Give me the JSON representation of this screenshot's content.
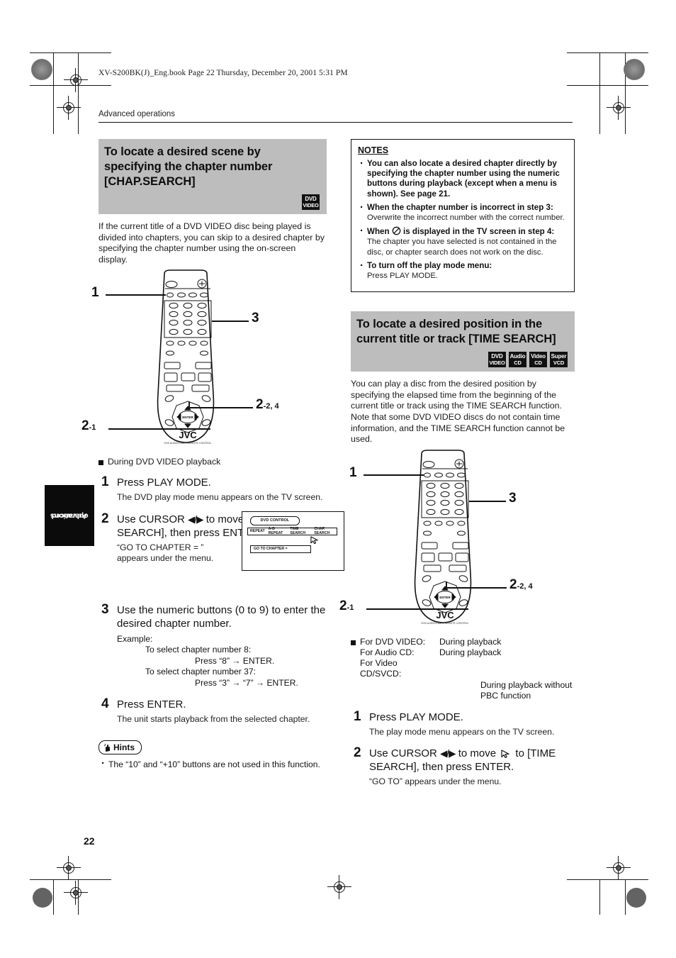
{
  "header": {
    "file_line": "XV-S200BK(J)_Eng.book  Page 22  Thursday, December 20, 2001  5:31 PM",
    "section": "Advanced operations"
  },
  "side_tab": {
    "line1": "Advanced",
    "line2": "operations"
  },
  "page_number": "22",
  "left": {
    "banner": {
      "title": "To locate a desired scene by specifying the chapter number [CHAP.SEARCH]",
      "badges": [
        {
          "top": "DVD",
          "bottom": "VIDEO"
        }
      ]
    },
    "intro": "If the current title of a DVD VIDEO disc being played is divided into chapters, you can skip to a desired chapter by specifying the chapter number using the on-screen display.",
    "remote_callouts": [
      {
        "num": "1",
        "sub": ""
      },
      {
        "num": "3",
        "sub": ""
      },
      {
        "num": "2",
        "sub": "-2, 4"
      },
      {
        "num": "2",
        "sub": "-1"
      }
    ],
    "condition": "During DVD VIDEO playback",
    "steps": [
      {
        "num": "1",
        "lead": "Press PLAY MODE.",
        "sub": "The DVD play mode menu appears on the TV screen."
      },
      {
        "num": "2",
        "lead_pre": "Use CURSOR ",
        "lead_cursor": "◀/▶",
        "lead_mid": " to move ",
        "lead_post": " to [CHAP. SEARCH], then press ENTER.",
        "sub": "“GO TO CHAPTER = ” appears under the menu."
      },
      {
        "num": "3",
        "lead": "Use the numeric buttons (0 to 9) to enter the desired chapter number.",
        "example_label": "Example:",
        "example_lines": [
          "To select chapter number 8:",
          "Press “8” → ENTER.",
          "To select chapter number 37:",
          "Press “3” → “7” → ENTER."
        ]
      },
      {
        "num": "4",
        "lead": "Press ENTER.",
        "sub": "The unit starts playback from the selected chapter."
      }
    ],
    "tv_screen": {
      "control_label": "DVD CONTROL",
      "menu_items": [
        "REPEAT",
        "A-B REPEAT",
        "TIME SEARCH",
        "CHAP. SEARCH"
      ],
      "goto_label": "GO TO CHAPTER ="
    },
    "hints": {
      "title": "Hints",
      "items": [
        "The “10” and “+10” buttons are not used in this function."
      ]
    }
  },
  "right": {
    "notes": {
      "title": "NOTES",
      "items": [
        {
          "bold": "You can also locate a desired chapter directly by specifying the chapter number using the numeric buttons during playback (except when a menu is shown). See page 21.",
          "plain": ""
        },
        {
          "bold": "When the chapter number is incorrect in step 3:",
          "plain": "Overwrite the incorrect number with the correct number."
        },
        {
          "bold_pre": "When ",
          "icon": "prohibited-icon",
          "bold_post": " is displayed in the TV screen in step 4:",
          "plain": "The chapter you have selected is not contained in the disc, or chapter search does not work on the disc."
        },
        {
          "bold": "To turn off the play mode menu:",
          "plain": "Press PLAY MODE."
        }
      ]
    },
    "banner": {
      "title": "To locate a desired position in the current title or track [TIME SEARCH]",
      "badges": [
        {
          "top": "DVD",
          "bottom": "VIDEO"
        },
        {
          "top": "Audio",
          "bottom": "CD"
        },
        {
          "top": "Video",
          "bottom": "CD"
        },
        {
          "top": "Super",
          "bottom": "VCD"
        }
      ]
    },
    "intro": "You can play a disc from the desired position by specifying the elapsed time from the beginning of the current title or track using the TIME SEARCH function. Note that some DVD VIDEO discs do not contain time information, and the TIME SEARCH function cannot be used.",
    "remote_callouts": [
      {
        "num": "1",
        "sub": ""
      },
      {
        "num": "3",
        "sub": ""
      },
      {
        "num": "2",
        "sub": "-2, 4"
      },
      {
        "num": "2",
        "sub": "-1"
      }
    ],
    "conditions": [
      {
        "k": "For DVD VIDEO:",
        "v": "During playback"
      },
      {
        "k": "For Audio CD:",
        "v": "During playback"
      },
      {
        "k": "For Video CD/SVCD:",
        "v": ""
      },
      {
        "k": "",
        "v": "During playback without PBC function"
      }
    ],
    "steps": [
      {
        "num": "1",
        "lead": "Press PLAY MODE.",
        "sub": "The play mode menu appears on the TV screen."
      },
      {
        "num": "2",
        "lead_pre": "Use CURSOR ",
        "lead_cursor": "◀/▶",
        "lead_mid": " to move ",
        "lead_post": " to [TIME SEARCH],  then press ENTER.",
        "sub": "“GO TO” appears under the menu."
      }
    ]
  },
  "remote": {
    "brand": "JVC",
    "brand_sub": "DVD AUDIO/VIDEO REMOTE CONTROL",
    "enter_label": "ENTER"
  }
}
